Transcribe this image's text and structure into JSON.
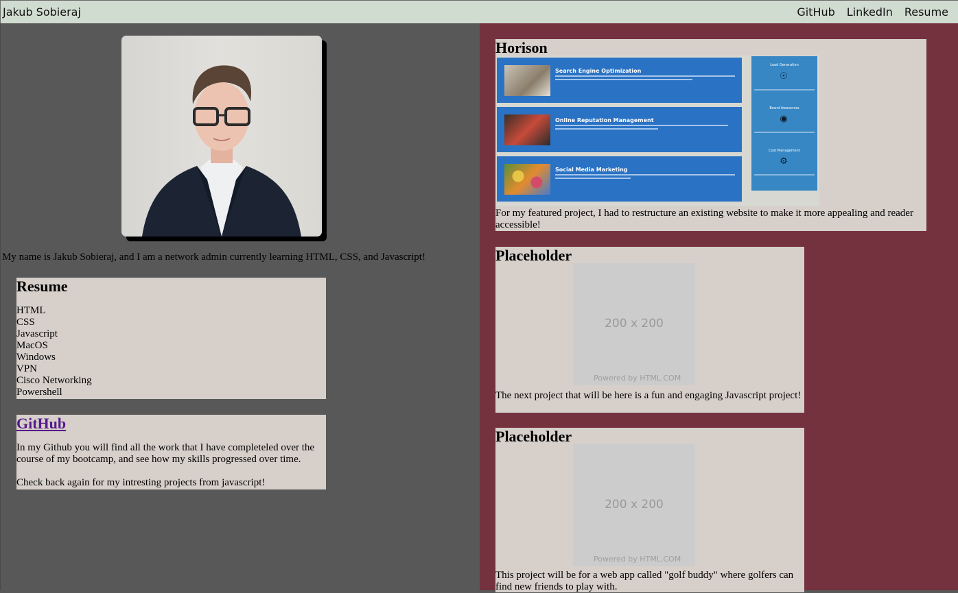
{
  "header": {
    "brand": "Jakub Sobieraj",
    "nav": [
      "GitHub",
      "LinkedIn",
      "Resume"
    ]
  },
  "profile": {
    "intro": "My name is Jakub Sobieraj, and I am a network admin currently learning HTML, CSS, and Javascript!"
  },
  "resume": {
    "title": "Resume",
    "skills": [
      "HTML",
      "CSS",
      "Javascript",
      "MacOS",
      "Windows",
      "VPN",
      "Cisco Networking",
      "Powershell"
    ]
  },
  "github": {
    "title": "GitHub",
    "paragraph1": "In my Github you will find all the work that I have completeled over the course of my bootcamp, and see how my skills progressed over time.",
    "paragraph2": "Check back again for my intresting projects from javascript!"
  },
  "projects": [
    {
      "title": "Horison",
      "description": "For my featured project, I had to restructure an existing website to make it more appealing and reader accessible!",
      "screenshot": {
        "rows": [
          "Search Engine Optimization",
          "Online Reputation Management",
          "Social Media Marketing"
        ],
        "side": [
          "Lead Generation",
          "Brand Awareness",
          "Cost Management"
        ]
      }
    },
    {
      "title": "Placeholder",
      "image_size": "200 x 200",
      "image_credit": "Powered by HTML.COM",
      "description": "The next project that will be here is a fun and engaging Javascript project!"
    },
    {
      "title": "Placeholder",
      "image_size": "200 x 200",
      "image_credit": "Powered by HTML.COM",
      "description": "This project will be for a web app called \"golf buddy\" where golfers can find new friends to play with."
    }
  ],
  "colors": {
    "header_bg": "#d1dcd0",
    "left_bg": "#585858",
    "right_bg": "#74323f",
    "card_bg": "#d6cfca",
    "link": "#551a8b"
  }
}
